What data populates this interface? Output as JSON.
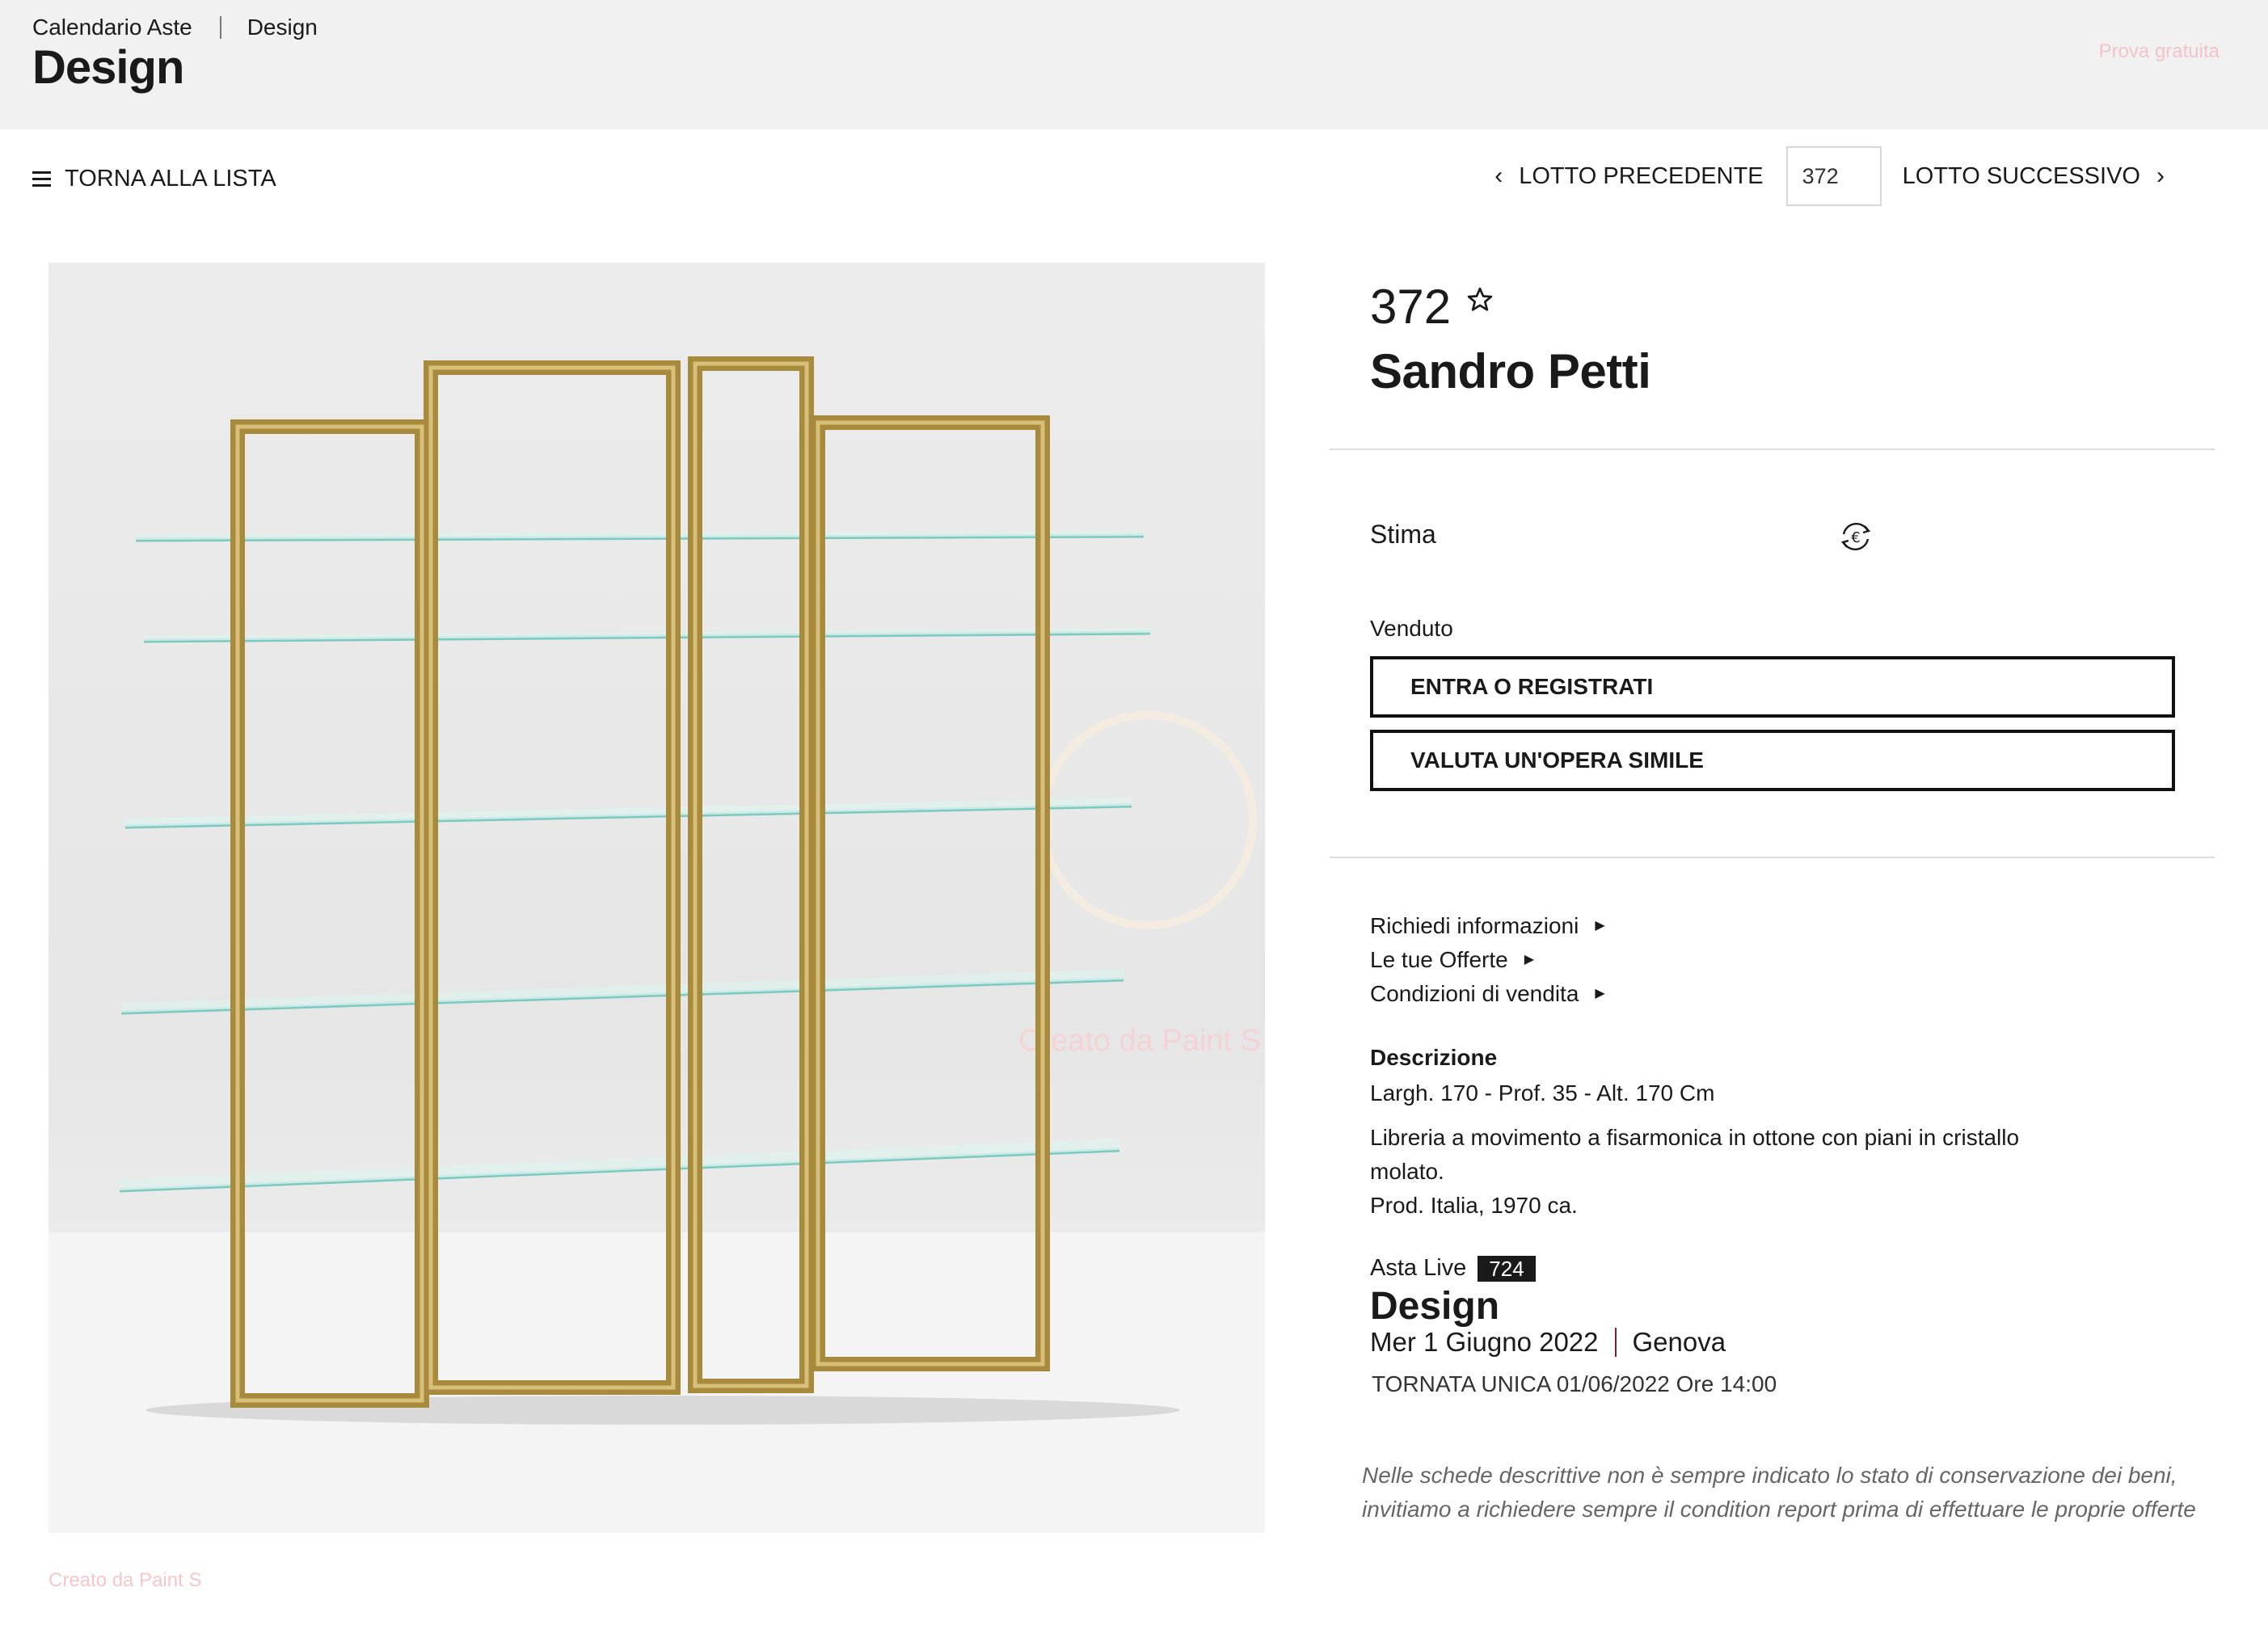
{
  "header": {
    "breadcrumb": [
      "Calendario Aste",
      "Design"
    ],
    "title": "Design",
    "trial_link": "Prova gratuita"
  },
  "nav": {
    "back_label": "TORNA ALLA LISTA",
    "prev_label": "LOTTO PRECEDENTE",
    "next_label": "LOTTO SUCCESSIVO",
    "lot_input_value": "372"
  },
  "image": {
    "watermark": "Creato da Paint S",
    "credit": "Creato da Paint S"
  },
  "lot": {
    "number": "372",
    "artist": "Sandro Petti",
    "stima_label": "Stima",
    "status": "Venduto",
    "login_button": "ENTRA O REGISTRATI",
    "evaluate_button": "VALUTA UN'OPERA SIMILE",
    "links": [
      "Richiedi informazioni",
      "Le tue Offerte",
      "Condizioni di vendita"
    ],
    "description_heading": "Descrizione",
    "dimensions": "Largh. 170 - Prof. 35 - Alt. 170 Cm",
    "description_lines": [
      "Libreria a movimento a fisarmonica in ottone con piani in cristallo molato.",
      "Prod. Italia, 1970 ca."
    ]
  },
  "auction": {
    "type": "Asta Live",
    "number": "724",
    "title": "Design",
    "date": "Mer 1 Giugno 2022",
    "city": "Genova",
    "session": "TORNATA UNICA 01/06/2022 Ore 14:00"
  },
  "note": "Nelle schede descrittive non è sempre indicato lo stato di conservazione dei beni, invitiamo a richiedere sempre il condition report prima di effettuare le proprie offerte",
  "icons": [
    "hamburger-icon",
    "chevron-left-icon",
    "chevron-right-icon",
    "star-icon",
    "currency-exchange-icon",
    "triangle-right-icon"
  ],
  "colors": {
    "topbar": "#f1f1f1",
    "badge": "#1a1a1a",
    "separator": "#7a2030",
    "trial": "#f2c3c7"
  }
}
